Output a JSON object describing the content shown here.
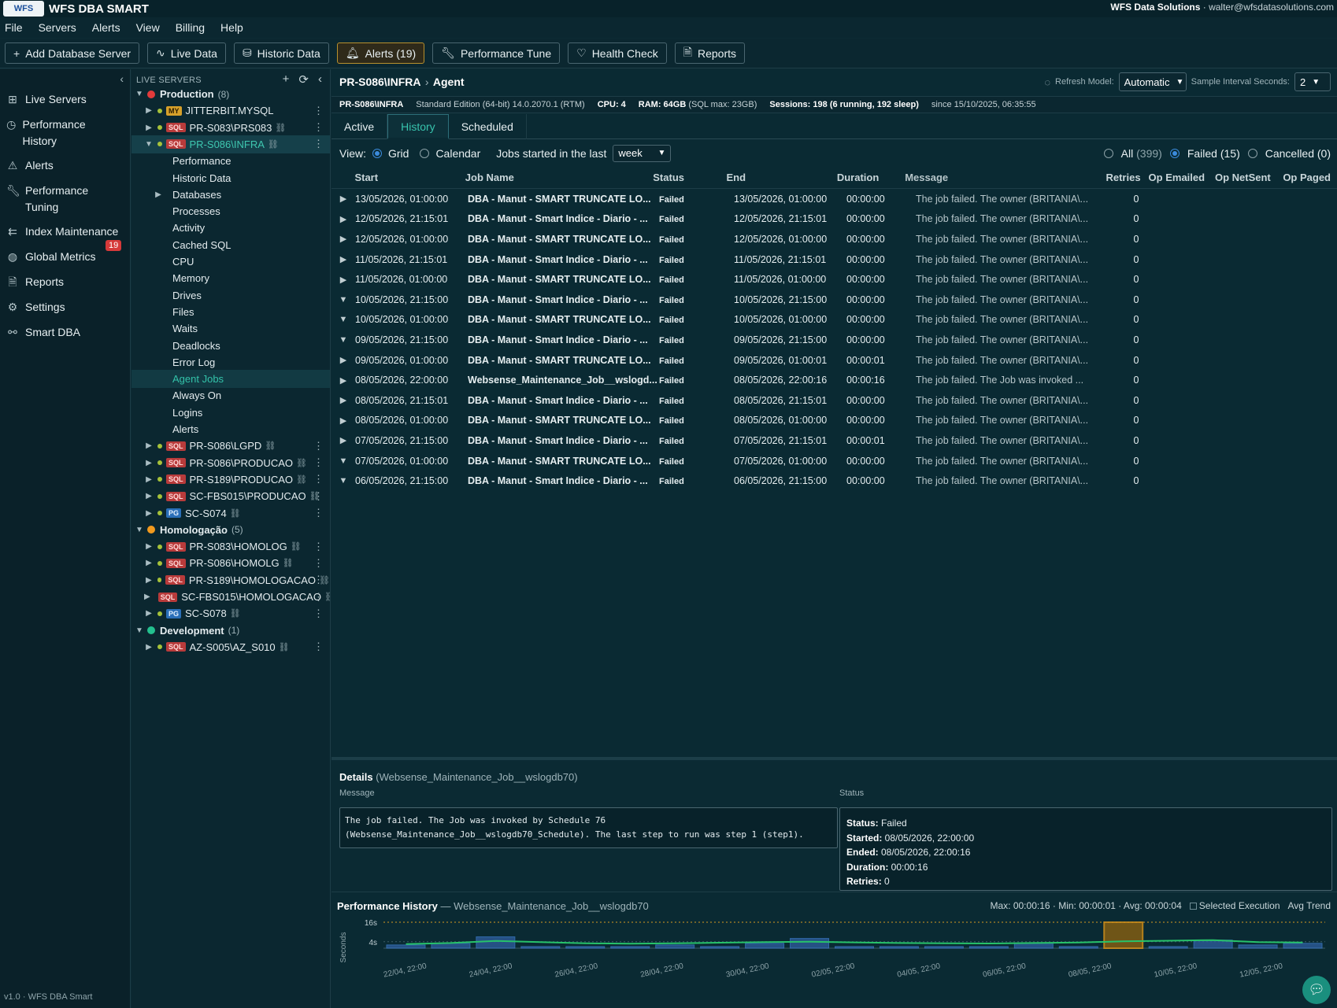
{
  "titlebar": {
    "logo_text": "WFS",
    "app_title": "WFS DBA SMART",
    "company": "WFS Data Solutions",
    "user": "· walter@wfsdatasolutions.com"
  },
  "menu": [
    "File",
    "Servers",
    "Alerts",
    "View",
    "Billing",
    "Help"
  ],
  "toolbar": [
    {
      "label": "Add Database Server",
      "icon": "plus-icon",
      "glyph": "+"
    },
    {
      "label": "Live Data",
      "icon": "pulse-icon",
      "glyph": "∿"
    },
    {
      "label": "Historic Data",
      "icon": "database-icon",
      "glyph": "⛁"
    },
    {
      "label": "Alerts (19)",
      "icon": "bell-icon",
      "glyph": "🔔︎"
    },
    {
      "label": "Performance Tune",
      "icon": "wrench-icon",
      "glyph": "🔧︎"
    },
    {
      "label": "Health Check",
      "icon": "heart-icon",
      "glyph": "♡"
    },
    {
      "label": "Reports",
      "icon": "report-icon",
      "glyph": "🗎"
    }
  ],
  "nav": {
    "items": [
      {
        "label": "Live Servers",
        "icon": "grid-icon",
        "glyph": "⊞"
      },
      {
        "label": "Performance History",
        "icon": "history-icon",
        "glyph": "◷"
      },
      {
        "label": "Alerts",
        "icon": "warning-icon",
        "glyph": "⚠"
      },
      {
        "label": "Performance Tuning",
        "icon": "wrench-icon",
        "glyph": "🔧︎"
      },
      {
        "label": "Index Maintenance",
        "icon": "index-icon",
        "glyph": "⇇"
      },
      {
        "label": "Global Metrics",
        "icon": "globe-icon",
        "glyph": "◍"
      },
      {
        "label": "Reports",
        "icon": "report-icon",
        "glyph": "🗎"
      },
      {
        "label": "Settings",
        "icon": "gear-icon",
        "glyph": "⚙"
      },
      {
        "label": "Smart DBA",
        "icon": "network-icon",
        "glyph": "⚯"
      }
    ],
    "alert_badge": "19",
    "version": "v1.0 · WFS DBA Smart"
  },
  "tree": {
    "header": "LIVE SERVERS",
    "groups": [
      {
        "name": "Production",
        "count": "(8)",
        "color": "#e23b3b"
      },
      {
        "name": "Homologação",
        "count": "(5)",
        "color": "#f29a1e"
      },
      {
        "name": "Development",
        "count": "(1)",
        "color": "#23c08e"
      }
    ],
    "servers": {
      "prod_a": [
        {
          "tag": "MY",
          "name": "JITTERBIT.MYSQL"
        },
        {
          "tag": "SQL",
          "name": "PR-S083\\PRS083"
        },
        {
          "tag": "SQL",
          "name": "PR-S086\\INFRA"
        }
      ],
      "prod_b": [
        {
          "tag": "SQL",
          "name": "PR-S086\\LGPD"
        },
        {
          "tag": "SQL",
          "name": "PR-S086\\PRODUCAO"
        },
        {
          "tag": "SQL",
          "name": "PR-S189\\PRODUCAO"
        },
        {
          "tag": "SQL",
          "name": "SC-FBS015\\PRODUCAO"
        },
        {
          "tag": "PG",
          "name": "SC-S074"
        }
      ],
      "homolog": [
        {
          "tag": "SQL",
          "name": "PR-S083\\HOMOLOG"
        },
        {
          "tag": "SQL",
          "name": "PR-S086\\HOMOLG"
        },
        {
          "tag": "SQL",
          "name": "PR-S189\\HOMOLOGACAO"
        },
        {
          "tag": "SQL",
          "name": "SC-FBS015\\HOMOLOGACAO"
        },
        {
          "tag": "PG",
          "name": "SC-S078"
        }
      ],
      "dev": [
        {
          "tag": "SQL",
          "name": "AZ-S005\\AZ_S010"
        }
      ]
    },
    "subitems": [
      "Performance",
      "Historic Data",
      "Databases",
      "Processes",
      "Activity",
      "Cached SQL",
      "CPU",
      "Memory",
      "Drives",
      "Files",
      "Waits",
      "Deadlocks",
      "Error Log",
      "Agent Jobs",
      "Always On",
      "Logins",
      "Alerts"
    ]
  },
  "main": {
    "crumb": {
      "server": "PR-S086\\INFRA",
      "sep": "›",
      "page": "Agent"
    },
    "refresh": {
      "label": "Refresh Model:",
      "value": "Automatic",
      "interval_label": "Sample Interval Seconds:",
      "interval": "2"
    },
    "info": {
      "server": "PR-S086\\INFRA",
      "edition": "Standard Edition (64-bit) 14.0.2070.1 (RTM)",
      "cpu": "CPU: 4",
      "ram": "RAM: 64GB",
      "ram_detail": "(SQL max: 23GB)",
      "sessions_label": "Sessions:",
      "sessions": "198 (6 running, 192 sleep)",
      "since": "since 15/10/2025, 06:35:55"
    },
    "tabs": [
      "Active",
      "History",
      "Scheduled"
    ],
    "view": {
      "label": "View:",
      "grid": "Grid",
      "calendar": "Calendar",
      "started_label": "Jobs started in the last",
      "period": "week"
    },
    "filters": {
      "all": "All",
      "all_count": "(399)",
      "failed": "Failed (15)",
      "cancelled": "Cancelled (0)"
    },
    "columns": [
      "Start",
      "Job Name",
      "Status",
      "End",
      "Duration",
      "Message",
      "Retries",
      "Op Emailed",
      "Op NetSent",
      "Op Paged"
    ],
    "rows": [
      {
        "exp": "▶",
        "start": "13/05/2026, 01:00:00",
        "name": "DBA - Manut - SMART TRUNCATE LO...",
        "status": "Failed",
        "end": "13/05/2026, 01:00:00",
        "dur": "00:00:00",
        "msg": "The job failed. The owner (BRITANIA\\...",
        "ret": "0"
      },
      {
        "exp": "▶",
        "start": "12/05/2026, 21:15:01",
        "name": "DBA - Manut - Smart Indice - Diario - ...",
        "status": "Failed",
        "end": "12/05/2026, 21:15:01",
        "dur": "00:00:00",
        "msg": "The job failed. The owner (BRITANIA\\...",
        "ret": "0"
      },
      {
        "exp": "▶",
        "start": "12/05/2026, 01:00:00",
        "name": "DBA - Manut - SMART TRUNCATE LO...",
        "status": "Failed",
        "end": "12/05/2026, 01:00:00",
        "dur": "00:00:00",
        "msg": "The job failed. The owner (BRITANIA\\...",
        "ret": "0"
      },
      {
        "exp": "▶",
        "start": "11/05/2026, 21:15:01",
        "name": "DBA - Manut - Smart Indice - Diario - ...",
        "status": "Failed",
        "end": "11/05/2026, 21:15:01",
        "dur": "00:00:00",
        "msg": "The job failed. The owner (BRITANIA\\...",
        "ret": "0"
      },
      {
        "exp": "▶",
        "start": "11/05/2026, 01:00:00",
        "name": "DBA - Manut - SMART TRUNCATE LO...",
        "status": "Failed",
        "end": "11/05/2026, 01:00:00",
        "dur": "00:00:00",
        "msg": "The job failed. The owner (BRITANIA\\...",
        "ret": "0"
      },
      {
        "exp": "▼",
        "start": "10/05/2026, 21:15:00",
        "name": "DBA - Manut - Smart Indice - Diario - ...",
        "status": "Failed",
        "end": "10/05/2026, 21:15:00",
        "dur": "00:00:00",
        "msg": "The job failed. The owner (BRITANIA\\...",
        "ret": "0"
      },
      {
        "exp": "▼",
        "start": "10/05/2026, 01:00:00",
        "name": "DBA - Manut - SMART TRUNCATE LO...",
        "status": "Failed",
        "end": "10/05/2026, 01:00:00",
        "dur": "00:00:00",
        "msg": "The job failed. The owner (BRITANIA\\...",
        "ret": "0"
      },
      {
        "exp": "▼",
        "start": "09/05/2026, 21:15:00",
        "name": "DBA - Manut - Smart Indice - Diario - ...",
        "status": "Failed",
        "end": "09/05/2026, 21:15:00",
        "dur": "00:00:00",
        "msg": "The job failed. The owner (BRITANIA\\...",
        "ret": "0"
      },
      {
        "exp": "▶",
        "start": "09/05/2026, 01:00:00",
        "name": "DBA - Manut - SMART TRUNCATE LO...",
        "status": "Failed",
        "end": "09/05/2026, 01:00:01",
        "dur": "00:00:01",
        "msg": "The job failed. The owner (BRITANIA\\...",
        "ret": "0"
      },
      {
        "exp": "▶",
        "start": "08/05/2026, 22:00:00",
        "name": "Websense_Maintenance_Job__wslogd...",
        "status": "Failed",
        "end": "08/05/2026, 22:00:16",
        "dur": "00:00:16",
        "msg": "The job failed. The Job was invoked ...",
        "ret": "0"
      },
      {
        "exp": "▶",
        "start": "08/05/2026, 21:15:01",
        "name": "DBA - Manut - Smart Indice - Diario - ...",
        "status": "Failed",
        "end": "08/05/2026, 21:15:01",
        "dur": "00:00:00",
        "msg": "The job failed. The owner (BRITANIA\\...",
        "ret": "0"
      },
      {
        "exp": "▶",
        "start": "08/05/2026, 01:00:00",
        "name": "DBA - Manut - SMART TRUNCATE LO...",
        "status": "Failed",
        "end": "08/05/2026, 01:00:00",
        "dur": "00:00:00",
        "msg": "The job failed. The owner (BRITANIA\\...",
        "ret": "0"
      },
      {
        "exp": "▶",
        "start": "07/05/2026, 21:15:00",
        "name": "DBA - Manut - Smart Indice - Diario - ...",
        "status": "Failed",
        "end": "07/05/2026, 21:15:01",
        "dur": "00:00:01",
        "msg": "The job failed. The owner (BRITANIA\\...",
        "ret": "0"
      },
      {
        "exp": "▼",
        "start": "07/05/2026, 01:00:00",
        "name": "DBA - Manut - SMART TRUNCATE LO...",
        "status": "Failed",
        "end": "07/05/2026, 01:00:00",
        "dur": "00:00:00",
        "msg": "The job failed. The owner (BRITANIA\\...",
        "ret": "0"
      },
      {
        "exp": "▼",
        "start": "06/05/2026, 21:15:00",
        "name": "DBA - Manut - Smart Indice - Diario - ...",
        "status": "Failed",
        "end": "06/05/2026, 21:15:00",
        "dur": "00:00:00",
        "msg": "The job failed. The owner (BRITANIA\\...",
        "ret": "0"
      }
    ],
    "details": {
      "title": "Details",
      "job": "(Websense_Maintenance_Job__wslogdb70)",
      "message_label": "Message",
      "message": "The job failed.  The Job was invoked by Schedule 76 (Websense_Maintenance_Job__wslogdb70_Schedule).  The last step to run was step 1 (step1).",
      "status_label": "Status",
      "status": [
        {
          "k": "Status:",
          "v": " Failed"
        },
        {
          "k": "Started:",
          "v": " 08/05/2026, 22:00:00"
        },
        {
          "k": "Ended:",
          "v": " 08/05/2026, 22:00:16"
        },
        {
          "k": "Duration:",
          "v": " 00:00:16"
        },
        {
          "k": "Retries:",
          "v": " 0"
        }
      ]
    },
    "perf": {
      "title": "Performance History",
      "job": "— Websense_Maintenance_Job__wslogdb70",
      "stats": "Max: 00:00:16 · Min: 00:00:01 · Avg: 00:00:04",
      "legend_selected": "Selected Execution",
      "legend_trend": "Avg Trend"
    }
  },
  "chart_data": {
    "type": "bar",
    "ylabel": "Seconds",
    "y_ticks": [
      "16s",
      "4s"
    ],
    "ylim": [
      0,
      16
    ],
    "x_ticks": [
      "22/04, 22:00",
      "24/04, 22:00",
      "26/04, 22:00",
      "28/04, 22:00",
      "30/04, 22:00",
      "02/05, 22:00",
      "04/05, 22:00",
      "06/05, 22:00",
      "08/05, 22:00",
      "10/05, 22:00",
      "12/05, 22:00"
    ],
    "values": [
      2,
      3,
      7,
      1,
      1,
      1,
      2,
      1,
      3,
      6,
      1,
      1,
      1,
      1,
      3,
      1,
      16,
      1,
      5,
      2,
      3
    ],
    "selected_index": 16,
    "max_line": 16,
    "avg_trend": [
      2.5,
      3.2,
      4.5,
      3.8,
      3.0,
      2.8,
      3.0,
      3.4,
      3.8,
      4.0,
      3.6,
      3.2,
      3.0,
      2.9,
      3.2,
      3.5,
      4.2,
      4.6,
      5.0,
      3.8,
      3.5
    ],
    "colors": {
      "bar": "#2e5fa0",
      "bar_border": "#3f7fd1",
      "selected": "#c88a1a",
      "trend": "#27c26a",
      "max": "#d69a22"
    }
  }
}
